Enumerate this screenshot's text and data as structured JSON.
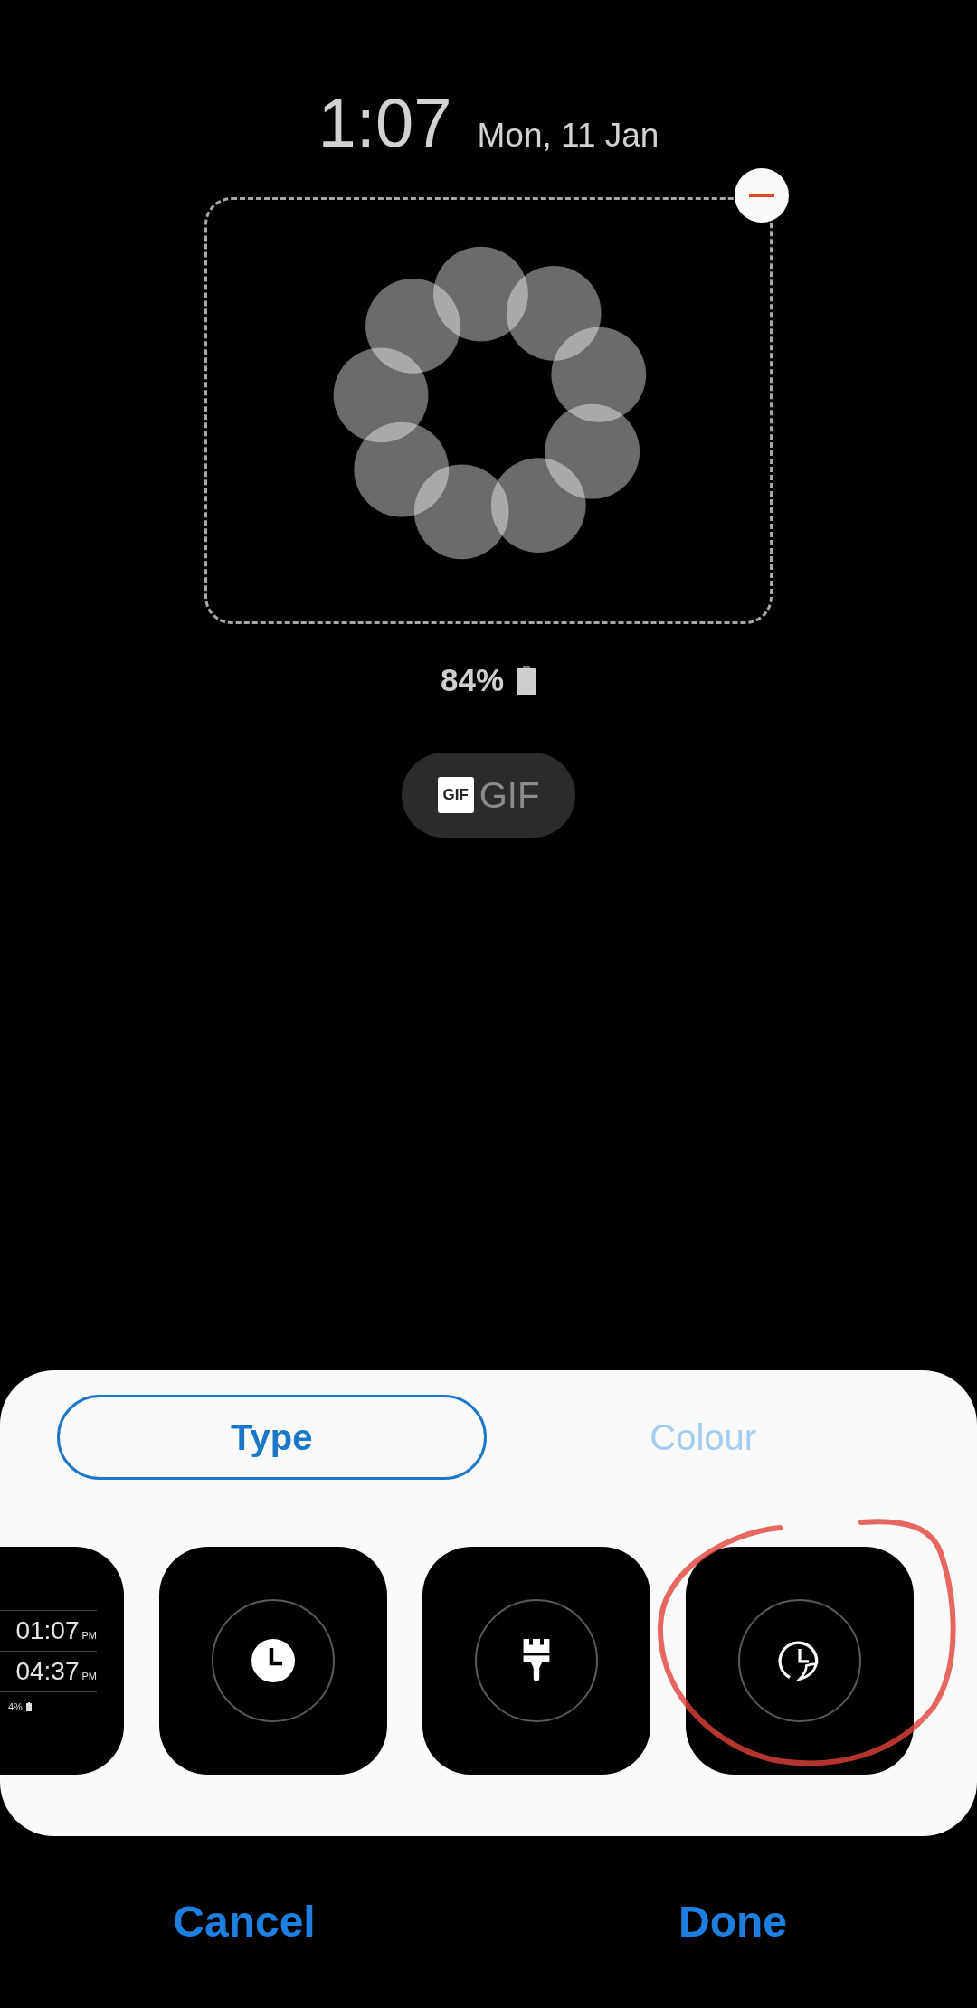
{
  "clock": {
    "time": "1:07",
    "date": "Mon, 11 Jan"
  },
  "widget": {
    "battery": "84%"
  },
  "gif_button": {
    "badge": "GIF",
    "label": "GIF"
  },
  "tabs": [
    {
      "label": "Type",
      "selected": true
    },
    {
      "label": "Colour",
      "selected": false
    }
  ],
  "styles": [
    {
      "kind": "preview",
      "rows": [
        {
          "time": "01:07",
          "suffix": "PM"
        },
        {
          "time": "04:37",
          "suffix": "PM"
        }
      ],
      "battery": "4%"
    },
    {
      "kind": "clock"
    },
    {
      "kind": "brush"
    },
    {
      "kind": "dual_clock"
    }
  ],
  "actions": [
    "Cancel",
    "Done"
  ]
}
